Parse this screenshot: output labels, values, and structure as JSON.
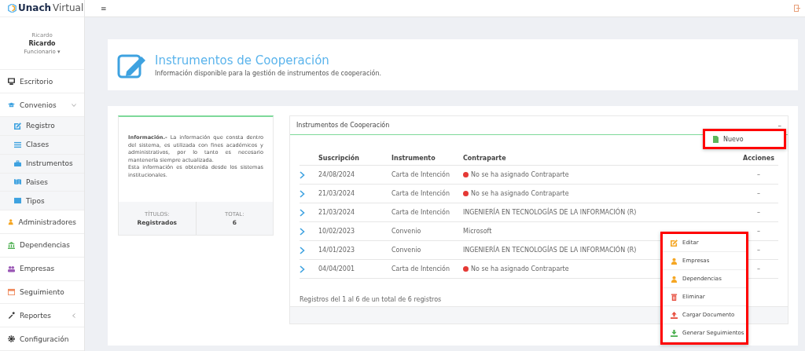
{
  "brand": {
    "bold": "Unach",
    "light": "Virtual"
  },
  "topbar": {
    "menu_glyph": "≡"
  },
  "user": {
    "avatar_alt": "Ricardo",
    "name": "Ricardo",
    "role": "Funcionario ▾"
  },
  "sidebar": {
    "items": [
      {
        "label": "Escritorio",
        "kind": "monitor",
        "color": "#333333"
      },
      {
        "label": "Convenios",
        "kind": "cap",
        "color": "#3ea2e0",
        "expanded": true,
        "children": [
          {
            "label": "Registro",
            "kind": "edit",
            "color": "#3ea2e0"
          },
          {
            "label": "Clases",
            "kind": "list",
            "color": "#3ea2e0"
          },
          {
            "label": "Instrumentos",
            "kind": "briefcase",
            "color": "#3ea2e0"
          },
          {
            "label": "Paises",
            "kind": "map",
            "color": "#3ea2e0"
          },
          {
            "label": "Tipos",
            "kind": "table",
            "color": "#3ea2e0"
          }
        ]
      },
      {
        "label": "Administradores",
        "kind": "user",
        "color": "#f5a623"
      },
      {
        "label": "Dependencias",
        "kind": "bank",
        "color": "#4caf50"
      },
      {
        "label": "Empresas",
        "kind": "users",
        "color": "#9b59b6"
      },
      {
        "label": "Seguimiento",
        "kind": "calendar",
        "color": "#f08a5d"
      },
      {
        "label": "Reportes",
        "kind": "dropper",
        "color": "#333333",
        "expanded": false
      },
      {
        "label": "Configuración",
        "kind": "gear",
        "color": "#333333"
      }
    ]
  },
  "header": {
    "title": "Instrumentos de Cooperación",
    "subtitle": "Información disponible para la gestión de instrumentos de cooperación."
  },
  "info_card": {
    "paragraphs": [
      "**Información.-** La información que consta dentro del sistema, es utilizada con fines académicos y administrativos, por lo tanto es necesario mantenerla siempre actualizada.",
      "Esta información es obtenida desde los sistemas institucionales."
    ],
    "stats": [
      {
        "label": "TÍTULOS:",
        "value": "Registrados"
      },
      {
        "label": "TOTAL:",
        "value": "6"
      }
    ]
  },
  "table_panel": {
    "title": "Instrumentos de Cooperación",
    "collapse_glyph": "–",
    "new_menu": {
      "highlighted": true,
      "items": [
        "Nuevo"
      ]
    },
    "columns": [
      "Suscripción",
      "Instrumento",
      "Contraparte",
      "Acciones"
    ],
    "rows": [
      {
        "date": "24/08/2024",
        "instrument": "Carta de Intención",
        "counterpart": "No se ha asignado Contraparte",
        "unassigned": true,
        "actions": "–"
      },
      {
        "date": "21/03/2024",
        "instrument": "Carta de Intención",
        "counterpart": "No se ha asignado Contraparte",
        "unassigned": true,
        "actions": "–"
      },
      {
        "date": "21/03/2024",
        "instrument": "Carta de Intención",
        "counterpart": "INGENIERÍA EN TECNOLOGÍAS DE LA INFORMACIÓN (R)",
        "unassigned": false,
        "actions": "–"
      },
      {
        "date": "10/02/2023",
        "instrument": "Convenio",
        "counterpart": "Microsoft",
        "unassigned": false,
        "actions": "–"
      },
      {
        "date": "14/01/2023",
        "instrument": "Convenio",
        "counterpart": "INGENIERÍA EN TECNOLOGÍAS DE LA INFORMACIÓN (R)",
        "unassigned": false,
        "actions": "–"
      },
      {
        "date": "04/04/2001",
        "instrument": "Carta de Intención",
        "counterpart": "No se ha asignado Contraparte",
        "unassigned": true,
        "actions": "–"
      }
    ],
    "footer": "Registros del 1 al 6 de un total de 6 registros",
    "actions_menu": {
      "highlighted": true,
      "items": [
        {
          "label": "Editar",
          "kind": "edit",
          "color": "#f5a623"
        },
        {
          "label": "Empresas",
          "kind": "user",
          "color": "#f5a623"
        },
        {
          "label": "Dependencias",
          "kind": "user",
          "color": "#f5a623"
        },
        {
          "label": "Eliminar",
          "kind": "trash",
          "color": "#e74c3c"
        },
        {
          "label": "Cargar Documento",
          "kind": "upload",
          "color": "#e74c3c"
        },
        {
          "label": "Generar Seguimientos",
          "kind": "download",
          "color": "#4caf50"
        }
      ]
    }
  }
}
